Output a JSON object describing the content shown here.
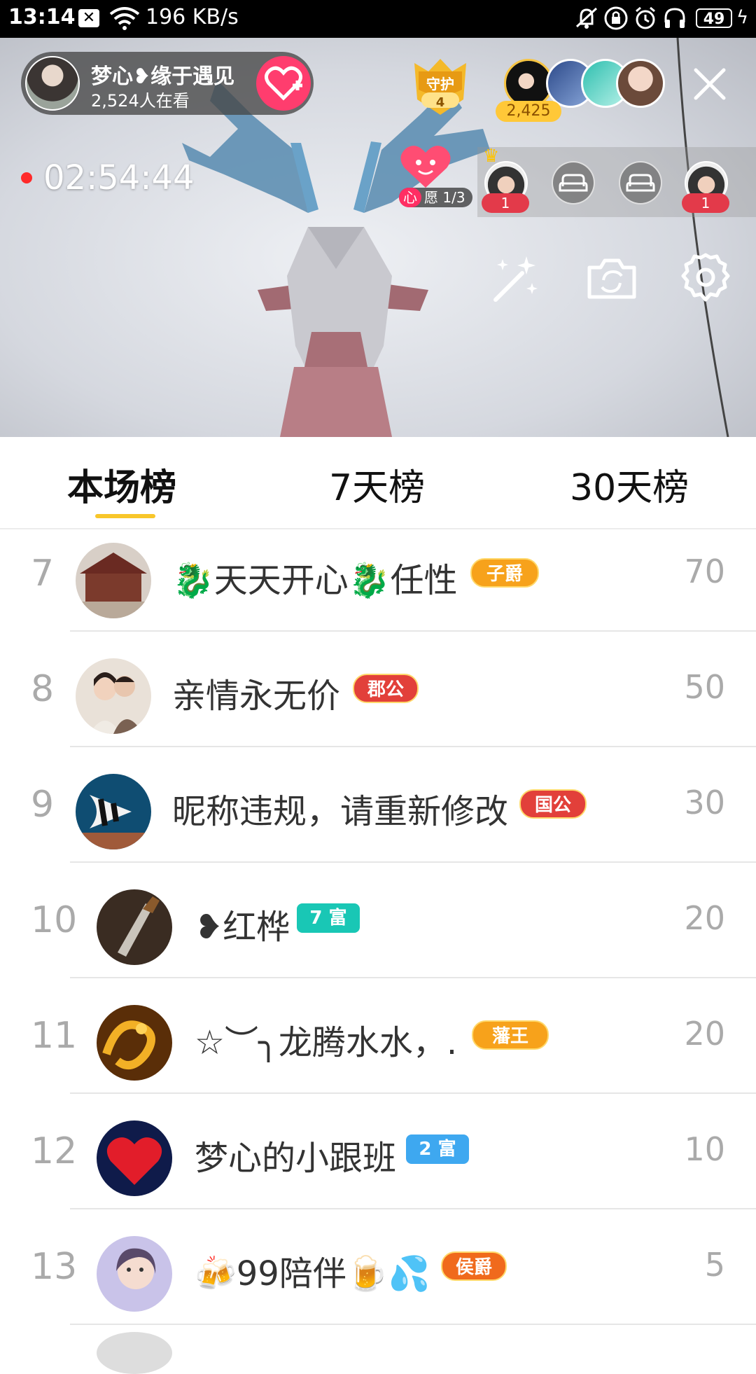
{
  "status_bar": {
    "time": "13:14",
    "net_speed": "196 KB/s",
    "battery": "49"
  },
  "host": {
    "name": "梦心❥缘于遇见",
    "viewers": "2,524人在看"
  },
  "guard": {
    "label": "守护",
    "count": "4"
  },
  "audience": {
    "count": "2,425"
  },
  "live": {
    "elapsed": "02:54:44"
  },
  "wish": {
    "prefix": "心",
    "label": "愿 1/3"
  },
  "seats": [
    {
      "type": "person",
      "count": "1"
    },
    {
      "type": "empty"
    },
    {
      "type": "empty"
    },
    {
      "type": "person",
      "count": "1"
    }
  ],
  "tabs": [
    {
      "label": "本场榜",
      "active": true
    },
    {
      "label": "7天榜",
      "active": false
    },
    {
      "label": "30天榜",
      "active": false
    }
  ],
  "leaderboard": [
    {
      "rank": "7",
      "name": "🐉天天开心🐉任性",
      "badge": "子爵",
      "score": "70"
    },
    {
      "rank": "8",
      "name": "亲情永无价",
      "badge": "郡公",
      "score": "50"
    },
    {
      "rank": "9",
      "name": "昵称违规，请重新修改",
      "badge": "国公",
      "score": "30"
    },
    {
      "rank": "10",
      "name": "❥红桦",
      "badge": "7 富",
      "score": "20"
    },
    {
      "rank": "11",
      "name": "☆︶╮龙腾水水，.",
      "badge": "藩王",
      "score": "20"
    },
    {
      "rank": "12",
      "name": "梦心的小跟班",
      "badge": "2 富",
      "score": "10"
    },
    {
      "rank": "13",
      "name": "🍻99陪伴🍺💦",
      "badge": "侯爵",
      "score": "5"
    }
  ],
  "colors": {
    "accent_yellow": "#f8c62a",
    "follow_pink": "#ff3d6e",
    "badge_orange": "#f7a21b",
    "badge_red": "#e2403a",
    "badge_teal": "#19c7b5",
    "badge_blue": "#3ea8f0"
  }
}
